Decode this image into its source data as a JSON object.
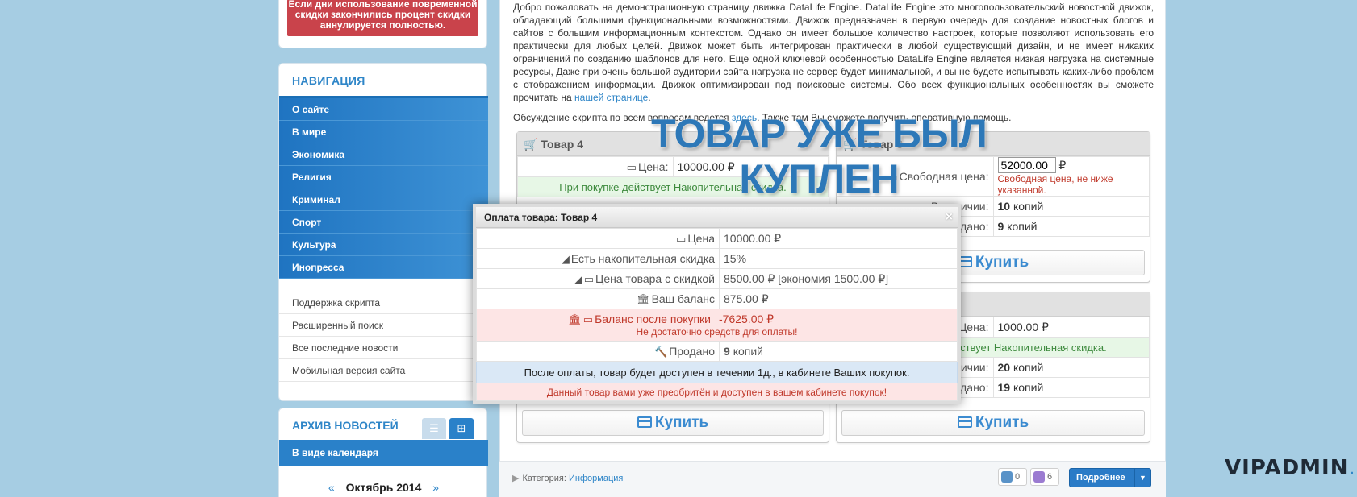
{
  "promo": {
    "line1": "Если дни использование повременной",
    "line2": "скидки закончились процент скидки",
    "line3": "аннулируется полностью."
  },
  "nav": {
    "title": "НАВИГАЦИЯ",
    "items": [
      {
        "label": "О сайте"
      },
      {
        "label": "В мире"
      },
      {
        "label": "Экономика"
      },
      {
        "label": "Религия"
      },
      {
        "label": "Криминал"
      },
      {
        "label": "Спорт"
      },
      {
        "label": "Культура"
      },
      {
        "label": "Инопресса"
      }
    ],
    "sub_items": [
      {
        "label": "Поддержка скрипта"
      },
      {
        "label": "Расширенный поиск"
      },
      {
        "label": "Все последние новости"
      },
      {
        "label": "Мобильная версия сайта"
      }
    ]
  },
  "archive": {
    "title": "АРХИВ НОВОСТЕЙ",
    "calendar_label": "В виде календаря",
    "month": "Октябрь 2014",
    "prev": "«",
    "next": "»"
  },
  "article": {
    "text": "Добро пожаловать на демонстрационную страницу движка DataLife Engine. DataLife Engine это многопользовательский новостной движок, обладающий большими функциональными возможностями. Движок предназначен в первую очередь для создание новостных блогов и сайтов с большим информационным контекстом. Однако он имеет большое количество настроек, которые позволяют использовать его практически для любых целей. Движок может быть интегрирован практически в любой существующий дизайн, и не имеет никаких ограничений по созданию шаблонов для него. Еще одной ключевой особенностью DataLife Engine является низкая нагрузка на системные ресурсы, Даже при очень большой аудитории сайта нагрузка не сервер будет минимальной, и вы не будете испытывать каких-либо проблем с отображением информации. Движок оптимизирован под поисковые системы. Обо всех функциональных особенностях вы сможете прочитать на",
    "link": "нашей странице",
    "end": ".",
    "discuss_pre": "Обсуждение скрипта по всем вопросам ведется",
    "discuss_link": "здесь",
    "discuss_post": ". Также там Вы сможете получить оперативную помощь."
  },
  "products": {
    "p1": {
      "title": "Товар 4",
      "price_label": "Цена:",
      "price": "10000.00 ₽",
      "note": "При покупке действует Накопительная скидка."
    },
    "p2": {
      "title": "Товар 3",
      "price_label": "Свободная цена:",
      "price_input": "52000.00",
      "currency": "₽",
      "price_note": "Свободная цена, не ниже указанной.",
      "stock_label": "В наличии:",
      "stock": "10",
      "stock_unit": "копий",
      "sold_label": "Продано:",
      "sold": "9",
      "sold_unit": "копий",
      "buy": "Купить"
    },
    "p3": {
      "buy": "Купить"
    },
    "p4": {
      "price_label": "Цена:",
      "price": "1000.00 ₽",
      "note": "При покупке действует Накопительная скидка.",
      "stock_label": "В наличии:",
      "stock": "20",
      "stock_unit": "копий",
      "sold_label": "Продано:",
      "sold": "19",
      "sold_unit": "копий",
      "buy": "Купить"
    }
  },
  "overlay": {
    "line1": "ТОВАР УЖЕ БЫЛ",
    "line2": "КУПЛЕН"
  },
  "modal": {
    "title": "Оплата товара: Товар 4",
    "close": "×",
    "rows": {
      "price_label": "Цена",
      "price": "10000.00 ₽",
      "discount_label": "Есть накопительная скидка",
      "discount": "15%",
      "disc_price_label": "Цена товара с скидкой",
      "disc_price": "8500.00 ₽ [экономия 1500.00 ₽]",
      "balance_label": "Ваш баланс",
      "balance": "875.00 ₽",
      "after_label": "Баланс после покупки",
      "after": "-7625.00 ₽",
      "after_note": "Не достаточно средств для оплаты!",
      "sold_label": "Продано",
      "sold": "9",
      "sold_unit": "копий"
    },
    "info": "После оплаты, товар будет доступен в течении 1д., в кабинете Ваших покупок.",
    "warning": "Данный товар вами уже преобритён и доступен в вашем кабинете покупок!"
  },
  "footer": {
    "category_label": "Категория:",
    "category": "Информация",
    "comments": "0",
    "views": "6",
    "more": "Подробнее"
  },
  "brand": {
    "main": "VIPADMIN",
    "suffix": ".club"
  }
}
